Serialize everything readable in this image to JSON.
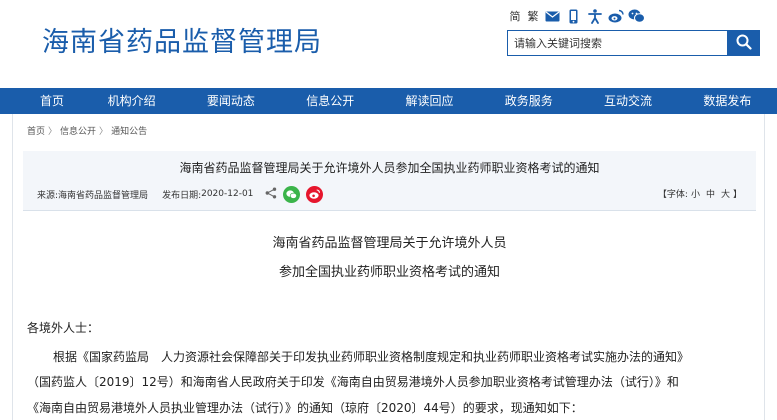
{
  "header": {
    "site_title": "海南省药品监督管理局",
    "toolbar": {
      "lang_label": "简 繁",
      "icons": [
        "mail-icon",
        "mobile-icon",
        "accessibility-icon",
        "weibo-icon",
        "wechat-icon"
      ]
    },
    "search": {
      "placeholder": "请输入关键词搜索",
      "button_icon": "search-icon"
    }
  },
  "nav": {
    "items": [
      "首页",
      "机构介绍",
      "要闻动态",
      "信息公开",
      "解读回应",
      "政务服务",
      "互动交流",
      "数据发布"
    ]
  },
  "breadcrumb": {
    "items": [
      "首页",
      "信息公开",
      "通知公告"
    ],
    "separator": "〉"
  },
  "article": {
    "head_title": "海南省药品监督管理局关于允许境外人员参加全国执业药师职业资格考试的通知",
    "source_label": "来源:",
    "source_value": "海南省药品监督管理局",
    "date_label": "发布日期:",
    "date_value": "2020-12-01",
    "font_label": "【字体:",
    "font_small": "小",
    "font_medium": "中",
    "font_large": "大",
    "font_end": "】",
    "title_line1": "海南省药品监督管理局关于允许境外人员",
    "title_line2": "参加全国执业药师职业资格考试的通知",
    "salutation": "各境外人士：",
    "para_line1": "根据《国家药监局　人力资源社会保障部关于印发执业药师职业资格制度规定和执业药师职业资格考试实施办法的通知》",
    "para_line2": "（国药监人〔2019〕12号）和海南省人民政府关于印发《海南自由贸易港境外人员参加职业资格考试管理办法（试行）》和",
    "para_line3": "《海南自由贸易港境外人员执业管理办法（试行）》的通知（琼府〔2020〕44号）的要求，现通知如下："
  },
  "colors": {
    "brand_blue": "#1a5dab",
    "wechat_green": "#3bb44a",
    "weibo_red": "#e6162d"
  }
}
